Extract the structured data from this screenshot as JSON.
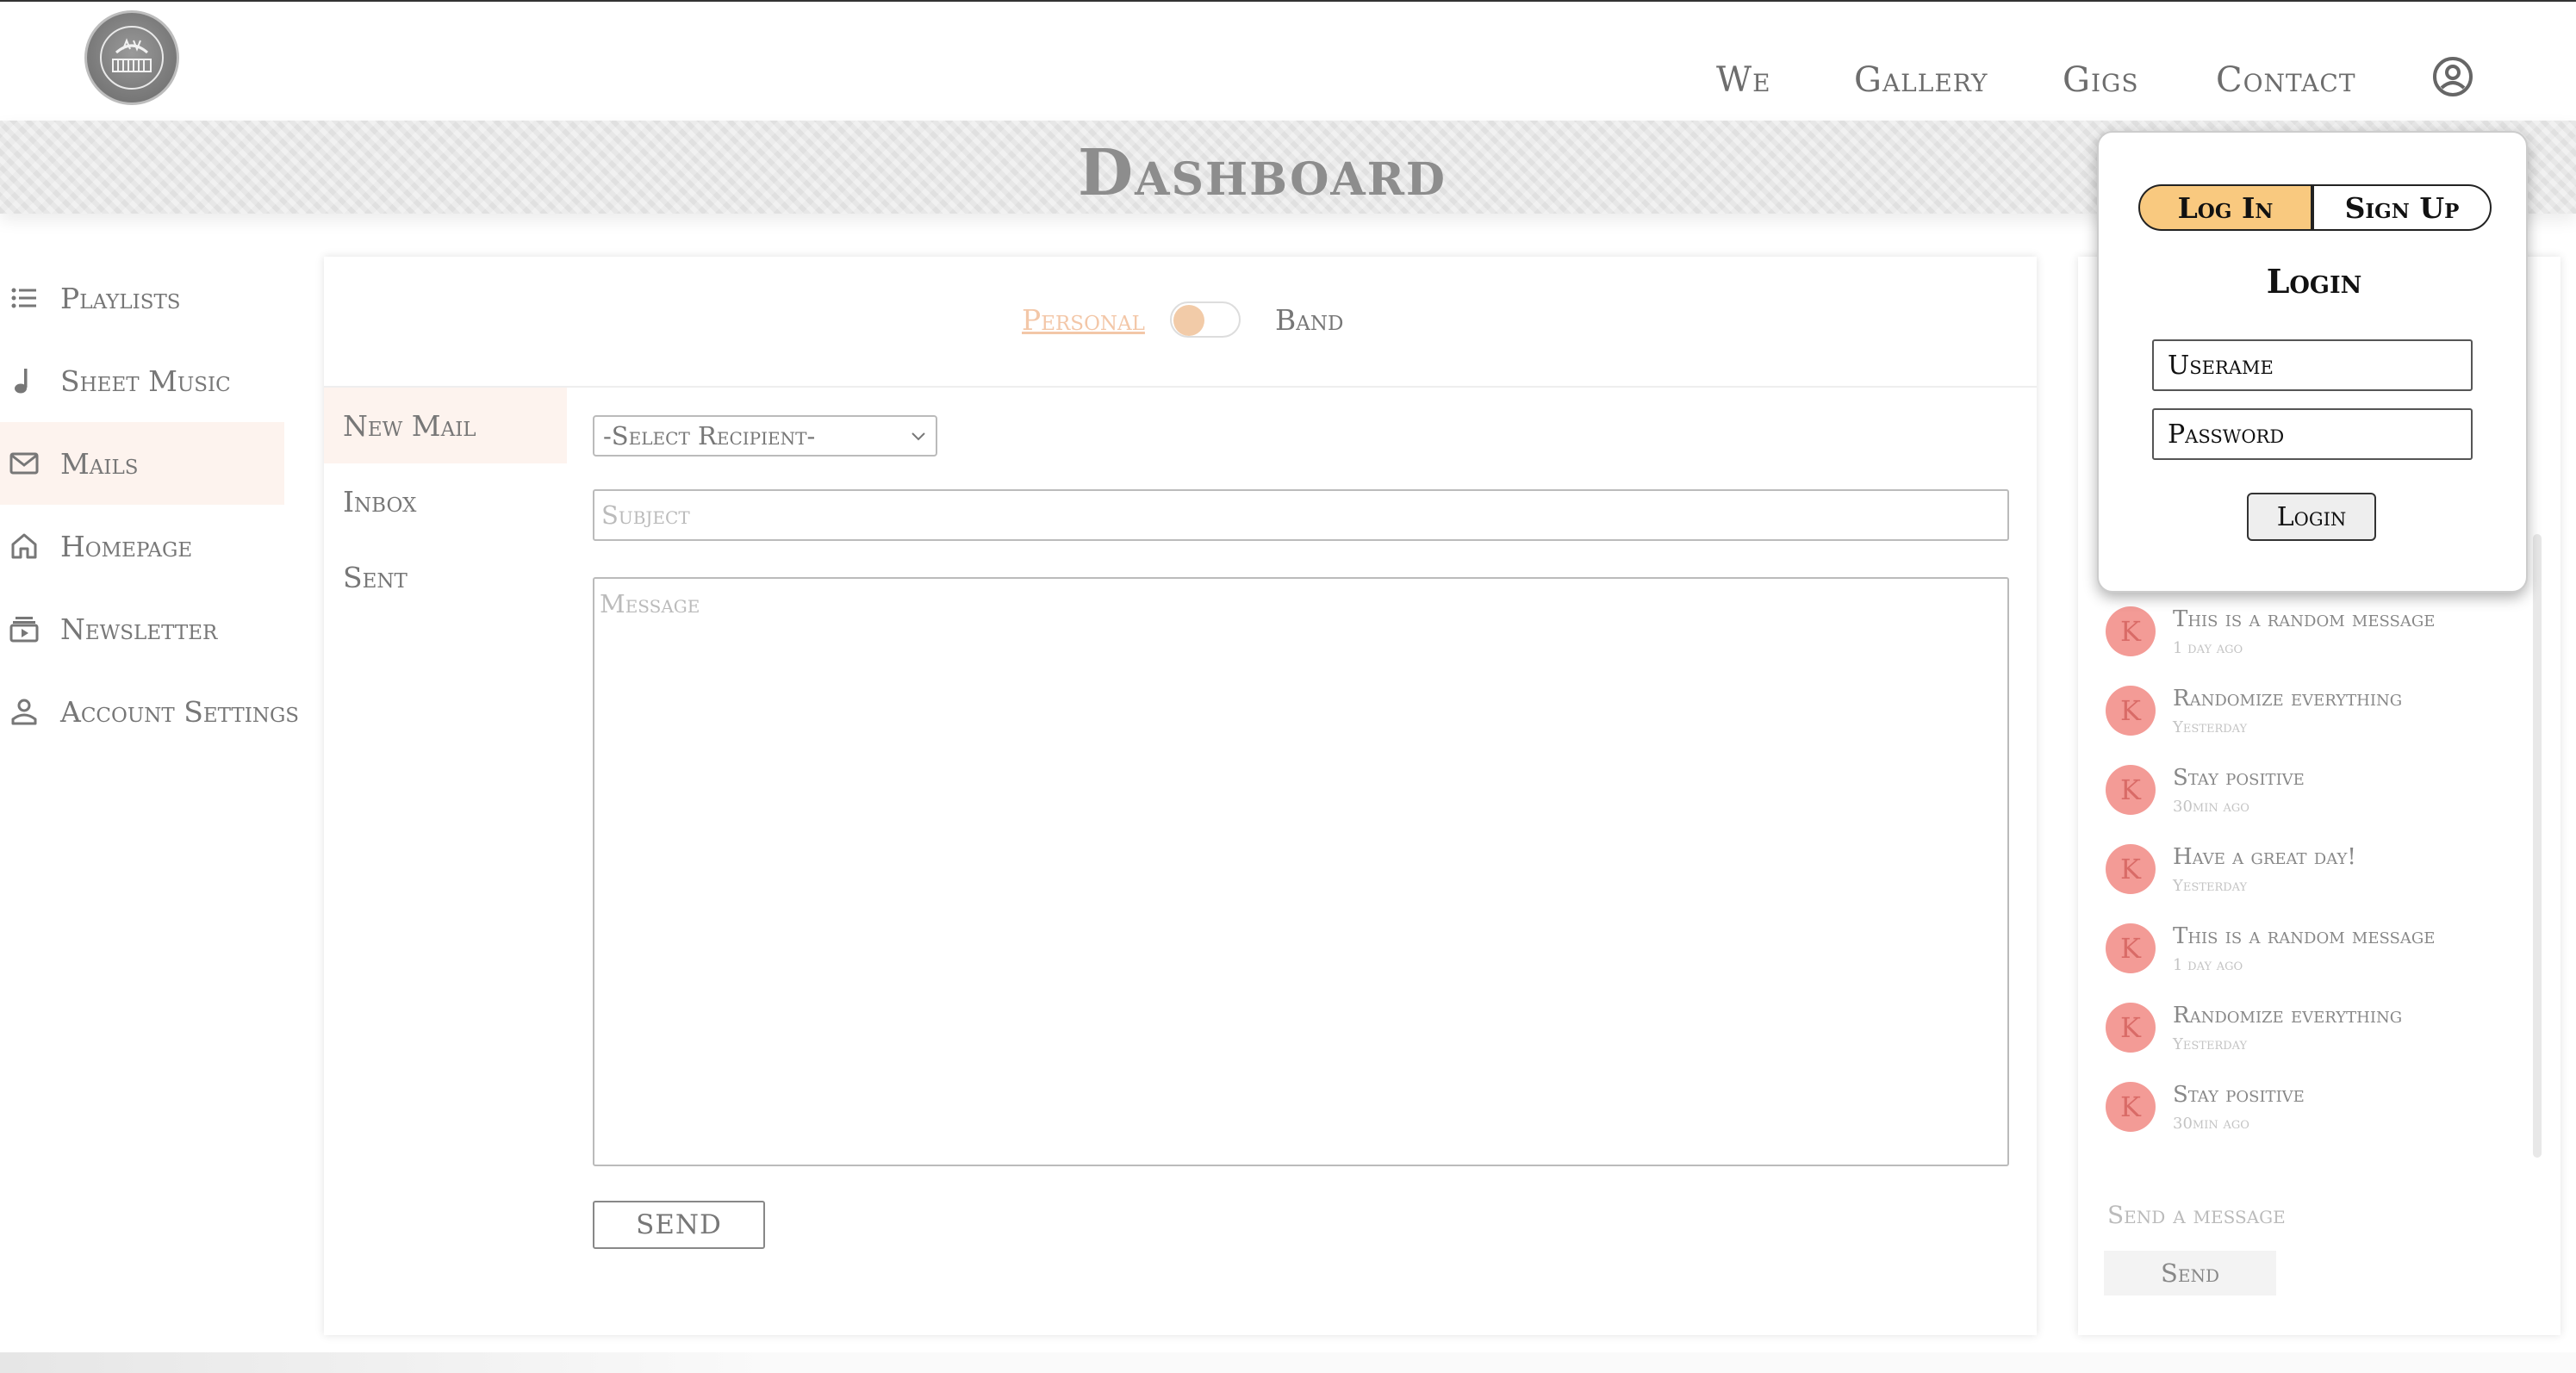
{
  "header": {
    "nav": [
      {
        "label": "We"
      },
      {
        "label": "Gallery"
      },
      {
        "label": "Gigs"
      },
      {
        "label": "Contact"
      }
    ],
    "user_icon": "user-circle-icon"
  },
  "banner": {
    "title": "Dashboard"
  },
  "sidebar": {
    "items": [
      {
        "label": "Playlists",
        "icon": "list-icon"
      },
      {
        "label": "Sheet Music",
        "icon": "music-note-icon"
      },
      {
        "label": "Mails",
        "icon": "mail-icon",
        "active": true
      },
      {
        "label": "Homepage",
        "icon": "home-icon"
      },
      {
        "label": "Newsletter",
        "icon": "newsletter-icon"
      },
      {
        "label": "Account Settings",
        "icon": "person-icon"
      }
    ]
  },
  "mail": {
    "toggle": {
      "left": "Personal",
      "right": "Band",
      "selected": "Personal"
    },
    "menu": [
      {
        "label": "New Mail",
        "active": true
      },
      {
        "label": "Inbox"
      },
      {
        "label": "Sent"
      }
    ],
    "recipient_select": "-Select Recipient-",
    "subject_placeholder": "Subject",
    "message_placeholder": "Message",
    "send_label": "SEND"
  },
  "chat": {
    "messages": [
      {
        "initial": "K",
        "text": "This is a random message",
        "time": "1 day ago"
      },
      {
        "initial": "K",
        "text": "Randomize everything",
        "time": "Yesterday"
      },
      {
        "initial": "K",
        "text": "Stay positive",
        "time": "30min ago"
      },
      {
        "initial": "K",
        "text": "Have a great day!",
        "time": "Yesterday"
      },
      {
        "initial": "K",
        "text": "This is a random message",
        "time": "1 day ago"
      },
      {
        "initial": "K",
        "text": "Randomize everything",
        "time": "Yesterday"
      },
      {
        "initial": "K",
        "text": "Stay positive",
        "time": "30min ago"
      }
    ],
    "input_placeholder": "Send a message",
    "send_label": "Send"
  },
  "login_popup": {
    "tab_login": "Log In",
    "tab_signup": "Sign Up",
    "title": "Login",
    "username_placeholder": "Userame",
    "password_placeholder": "Password",
    "button_label": "Login"
  },
  "colors": {
    "accent": "#f9c97f",
    "active_bg": "#fdf3ee",
    "avatar": "#f39b96",
    "personal_link": "#f3c7a8"
  }
}
